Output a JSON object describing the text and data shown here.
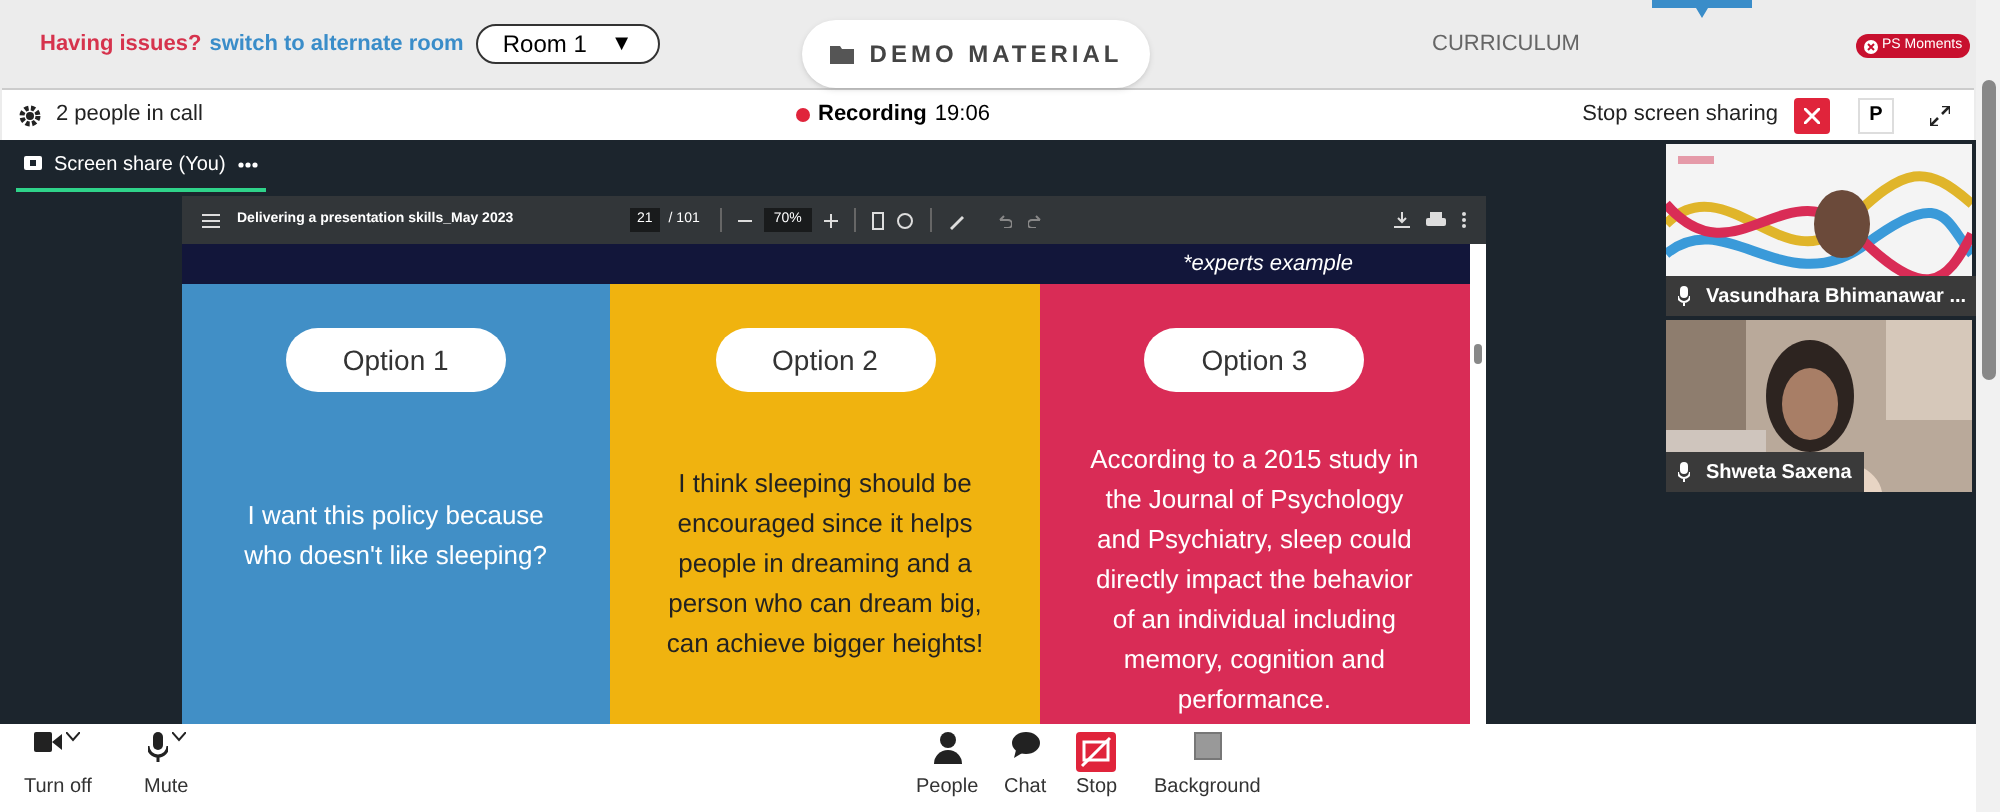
{
  "top_bar": {
    "issue_text": "Having issues?",
    "switch_link": "switch to alternate room",
    "room_select": "Room 1",
    "room_caret": "▼",
    "demo_material": "DEMO MATERIAL",
    "curriculum": "CURRICULUM",
    "ps_moments": "PS Moments"
  },
  "call_header": {
    "people": "2 people in call",
    "recording": true,
    "recording_label": "Recording",
    "recording_time": "19:06",
    "stop_sharing": "Stop screen sharing",
    "avatar": "P"
  },
  "share_tab": {
    "label": "Screen share (You)",
    "selected": true
  },
  "pdf_viewer": {
    "title": "Delivering a presentation skills_May 2023",
    "page": "21",
    "total": "/ 101",
    "zoom": "70%"
  },
  "slide": {
    "caption": "*experts example",
    "options": [
      {
        "label": "Option 1",
        "text": "I want this policy because who doesn't like sleeping?",
        "color": "#418fc6"
      },
      {
        "label": "Option 2",
        "text": "I think sleeping should be encouraged since it helps people in dreaming and a person who can dream big, can achieve bigger heights!",
        "color": "#f0b30f"
      },
      {
        "label": "Option 3",
        "text": "According to a 2015 study in the Journal of Psychology and Psychiatry, sleep could directly impact the behavior of an individual including memory, cognition and performance.",
        "color": "#d92c56"
      }
    ]
  },
  "participants": [
    {
      "name": "Vasundhara Bhimanawar ...",
      "kind": "branded"
    },
    {
      "name": "Shweta Saxena",
      "kind": "room"
    }
  ],
  "controls": [
    {
      "kind": "camera",
      "label": "Turn off",
      "has_menu": true
    },
    {
      "kind": "mic",
      "label": "Mute",
      "has_menu": true
    },
    {
      "kind": "people",
      "label": "People",
      "has_menu": false
    },
    {
      "kind": "chat",
      "label": "Chat",
      "has_menu": false
    },
    {
      "kind": "stop",
      "label": "Stop",
      "has_menu": false
    },
    {
      "kind": "background",
      "label": "Background",
      "has_menu": false
    }
  ]
}
